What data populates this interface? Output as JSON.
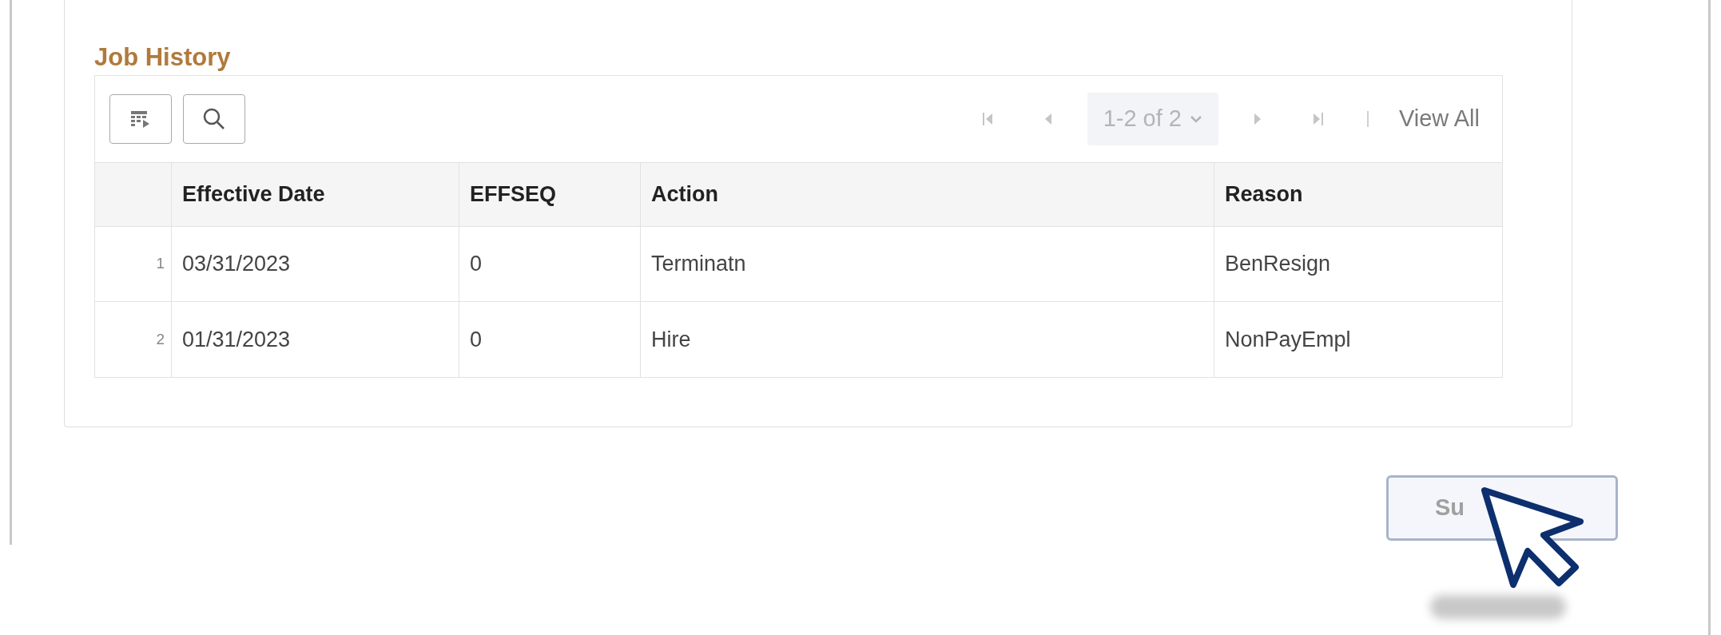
{
  "section": {
    "title": "Job History"
  },
  "toolbar": {
    "pager": "1-2 of 2",
    "view_all": "View All"
  },
  "table": {
    "columns": [
      "Effective Date",
      "EFFSEQ",
      "Action",
      "Reason"
    ],
    "rows": [
      {
        "number": "1",
        "cells": [
          "03/31/2023",
          "0",
          "Terminatn",
          "BenResign"
        ]
      },
      {
        "number": "2",
        "cells": [
          "01/31/2023",
          "0",
          "Hire",
          "NonPayEmpl"
        ]
      }
    ]
  },
  "submit_button": {
    "label": "Su"
  }
}
